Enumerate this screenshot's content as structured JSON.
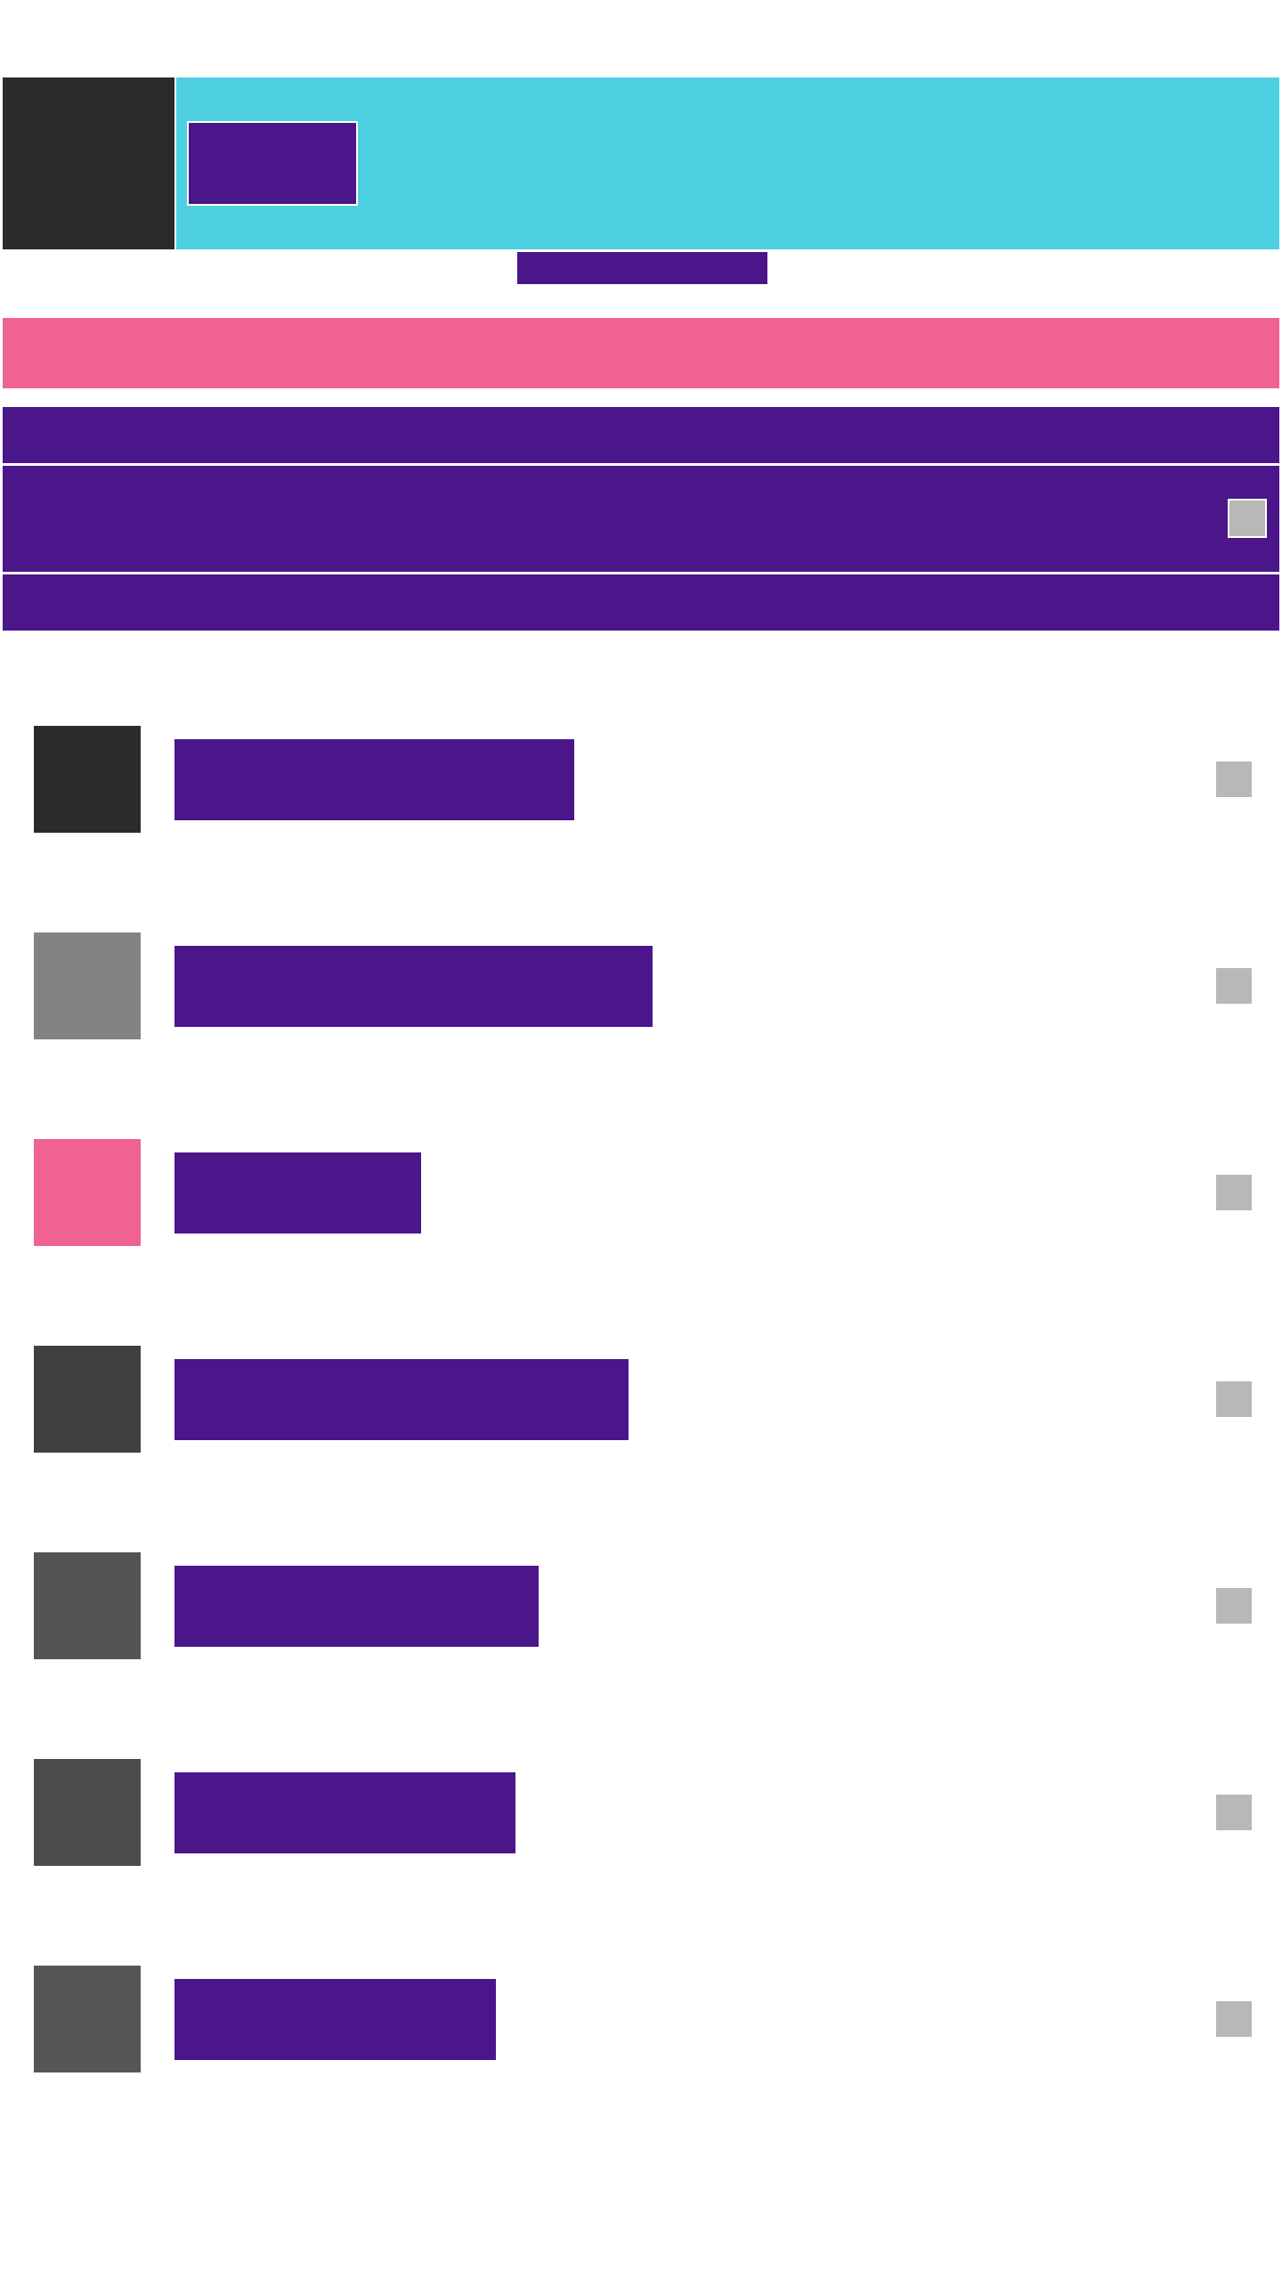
{
  "colors": {
    "primary": "#4a168a",
    "accent_cyan": "#4dd0e1",
    "accent_pink": "#f06292",
    "dark": "#2b2b2b",
    "control_gray": "#b8b8b8",
    "background": "#ffffff"
  },
  "header": {
    "thumbnail_color": "#2b2b2b",
    "banner_color": "#4dd0e1",
    "chip_label": "",
    "caption": ""
  },
  "alert": {
    "color": "#f06292",
    "text": ""
  },
  "info_rows": [
    {
      "text": ""
    },
    {
      "text": "",
      "toggle_icon": "checkbox-icon"
    },
    {
      "text": ""
    }
  ],
  "list": {
    "items": [
      {
        "thumb_color": "#2b2b2b",
        "label": "",
        "fill": 0.51,
        "action_icon": "more-icon"
      },
      {
        "thumb_color": "#838383",
        "label": "",
        "fill": 0.61,
        "action_icon": "more-icon"
      },
      {
        "thumb_color": "#f06292",
        "label": "",
        "fill": 0.315,
        "action_icon": "more-icon"
      },
      {
        "thumb_color": "#404040",
        "label": "",
        "fill": 0.58,
        "action_icon": "more-icon"
      },
      {
        "thumb_color": "#545454",
        "label": "",
        "fill": 0.465,
        "action_icon": "more-icon"
      },
      {
        "thumb_color": "#4b4b4b",
        "label": "",
        "fill": 0.435,
        "action_icon": "more-icon"
      },
      {
        "thumb_color": "#565656",
        "label": "",
        "fill": 0.41,
        "action_icon": "more-icon"
      }
    ]
  }
}
